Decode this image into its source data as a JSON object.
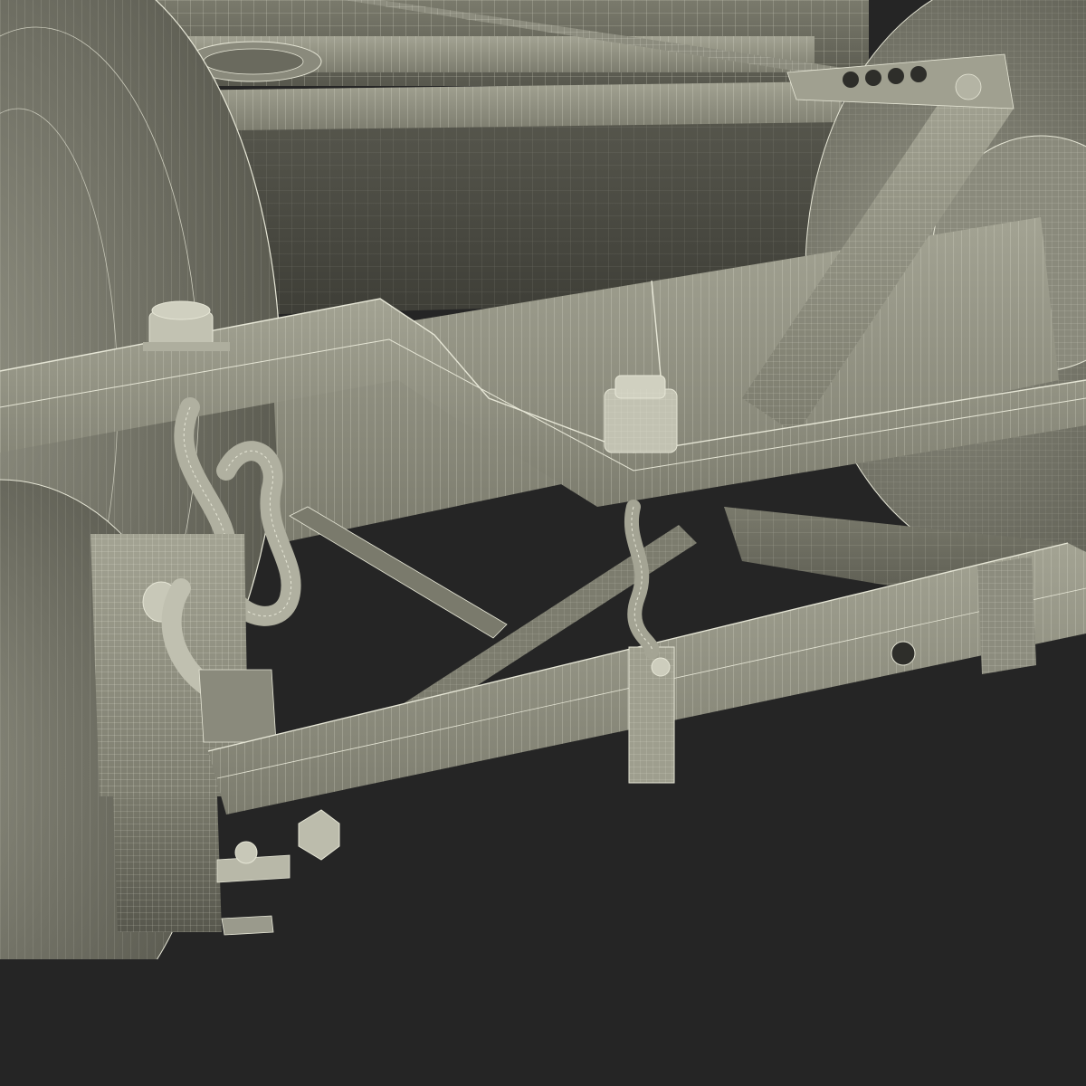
{
  "scene": {
    "background_color": "#252525",
    "model_fill_light": "#9a9a8a",
    "model_fill_mid": "#6e6e62",
    "model_fill_dark": "#4a4a42",
    "wire_color": "#e6e6d6",
    "shadow_color": "#3a3a34"
  }
}
